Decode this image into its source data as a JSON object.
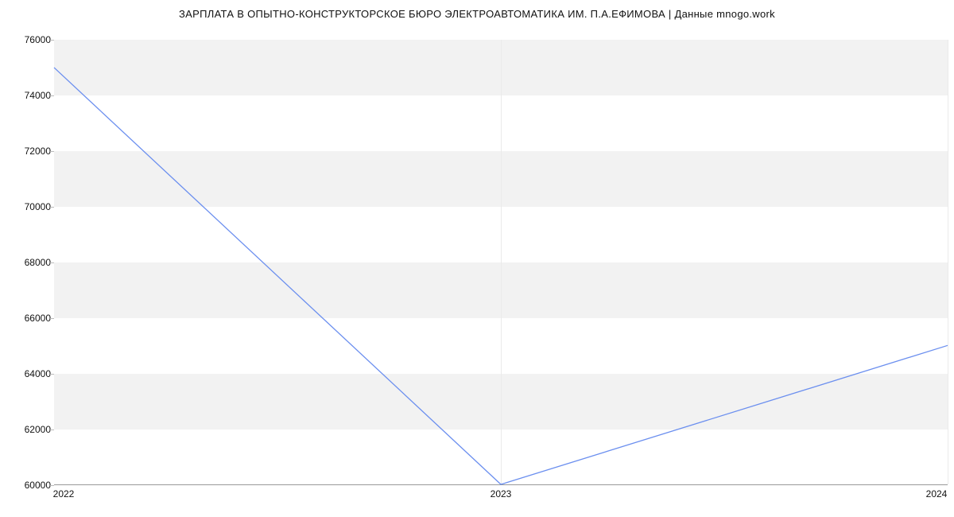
{
  "chart_data": {
    "type": "line",
    "title": "ЗАРПЛАТА В ОПЫТНО-КОНСТРУКТОРСКОЕ БЮРО ЭЛЕКТРОАВТОМАТИКА ИМ. П.А.ЕФИМОВА | Данные mnogo.work",
    "x": [
      2022,
      2023,
      2024
    ],
    "series": [
      {
        "name": "salary",
        "values": [
          75000,
          60000,
          65000
        ]
      }
    ],
    "x_ticks": [
      2022,
      2023,
      2024
    ],
    "y_ticks": [
      60000,
      62000,
      64000,
      66000,
      68000,
      70000,
      72000,
      74000,
      76000
    ],
    "ylim": [
      60000,
      76000
    ],
    "xlim": [
      2022,
      2024
    ],
    "xlabel": "",
    "ylabel": ""
  },
  "colors": {
    "line": "#6b8fef",
    "band": "#f2f2f2"
  }
}
